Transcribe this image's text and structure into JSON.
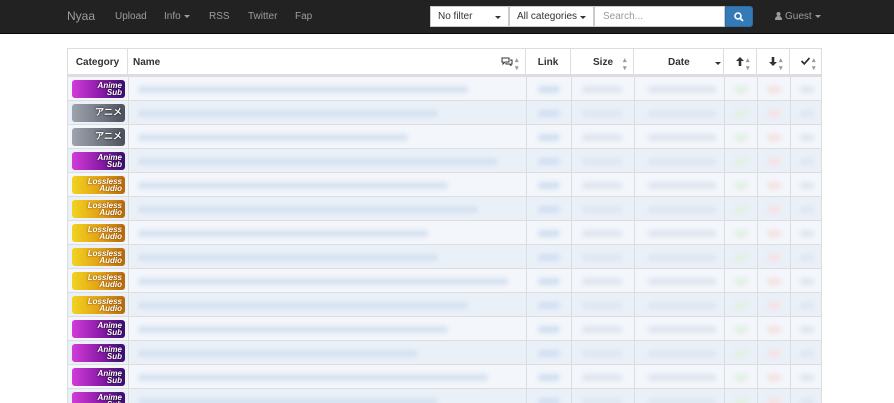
{
  "navbar": {
    "brand": "Nyaa",
    "links": {
      "upload": "Upload",
      "info": "Info",
      "rss": "RSS",
      "twitter": "Twitter",
      "fap": "Fap"
    },
    "filter_selected": "No filter",
    "category_selected": "All categories",
    "search_placeholder": "Search...",
    "user": "Guest"
  },
  "table": {
    "headers": {
      "category": "Category",
      "name": "Name",
      "link": "Link",
      "size": "Size",
      "date": "Date"
    },
    "rows": [
      {
        "category": "anime",
        "label_line1": "Anime",
        "label_line2": "Sub"
      },
      {
        "category": "raw",
        "label_line1": "アニメ",
        "label_line2": ""
      },
      {
        "category": "raw",
        "label_line1": "アニメ",
        "label_line2": ""
      },
      {
        "category": "anime",
        "label_line1": "Anime",
        "label_line2": "Sub"
      },
      {
        "category": "lossless",
        "label_line1": "Lossless",
        "label_line2": "Audio"
      },
      {
        "category": "lossless",
        "label_line1": "Lossless",
        "label_line2": "Audio"
      },
      {
        "category": "lossless",
        "label_line1": "Lossless",
        "label_line2": "Audio"
      },
      {
        "category": "lossless",
        "label_line1": "Lossless",
        "label_line2": "Audio"
      },
      {
        "category": "lossless",
        "label_line1": "Lossless",
        "label_line2": "Audio"
      },
      {
        "category": "lossless",
        "label_line1": "Lossless",
        "label_line2": "Audio"
      },
      {
        "category": "anime",
        "label_line1": "Anime",
        "label_line2": "Sub"
      },
      {
        "category": "anime",
        "label_line1": "Anime",
        "label_line2": "Sub"
      },
      {
        "category": "anime",
        "label_line1": "Anime",
        "label_line2": "Sub"
      },
      {
        "category": "anime",
        "label_line1": "Anime",
        "label_line2": "Sub"
      }
    ]
  },
  "colors": {
    "navbar_bg": "#222222",
    "search_button": "#337ab7",
    "anime": "#8a1aa8",
    "raw": "#6f7480",
    "lossless": "#e09a14"
  }
}
